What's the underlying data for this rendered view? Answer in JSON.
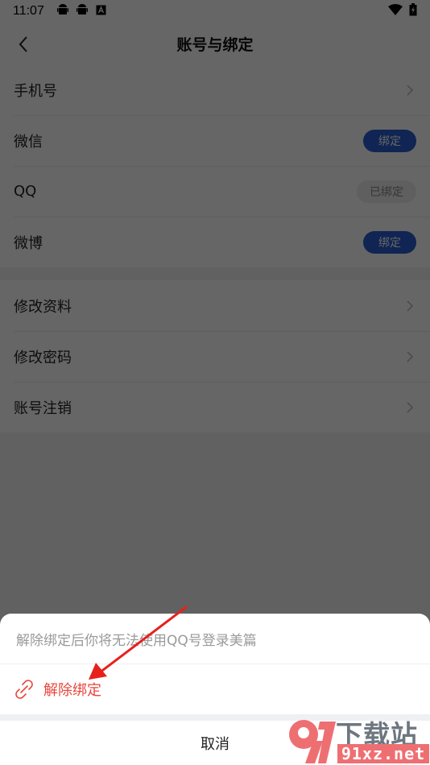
{
  "status_bar": {
    "time": "11:07",
    "left_icons": [
      "android-icon",
      "android-icon",
      "a-notification-icon"
    ],
    "right_icons": [
      "wifi-icon",
      "battery-charging-icon"
    ]
  },
  "nav": {
    "back_icon": "chevron-left-icon",
    "title": "账号与绑定"
  },
  "binding_section": {
    "rows": [
      {
        "label": "手机号",
        "action_type": "chevron"
      },
      {
        "label": "微信",
        "action_type": "button",
        "action_label": "绑定"
      },
      {
        "label": "QQ",
        "action_type": "badge",
        "action_label": "已绑定"
      },
      {
        "label": "微博",
        "action_type": "button",
        "action_label": "绑定"
      }
    ]
  },
  "settings_section": {
    "rows": [
      {
        "label": "修改资料"
      },
      {
        "label": "修改密码"
      },
      {
        "label": "账号注销"
      }
    ]
  },
  "bottom_sheet": {
    "hint": "解除绑定后你将无法使用QQ号登录美篇",
    "unbind_label": "解除绑定",
    "unbind_icon": "unlink-icon",
    "cancel_label": "取消"
  },
  "colors": {
    "primary_blue": "#2a5ccf",
    "danger_red": "#e8463c",
    "annotation_red": "#e8201c"
  },
  "watermark": {
    "brand": "下载站",
    "url": "91xz.net",
    "logo_text": "91"
  }
}
